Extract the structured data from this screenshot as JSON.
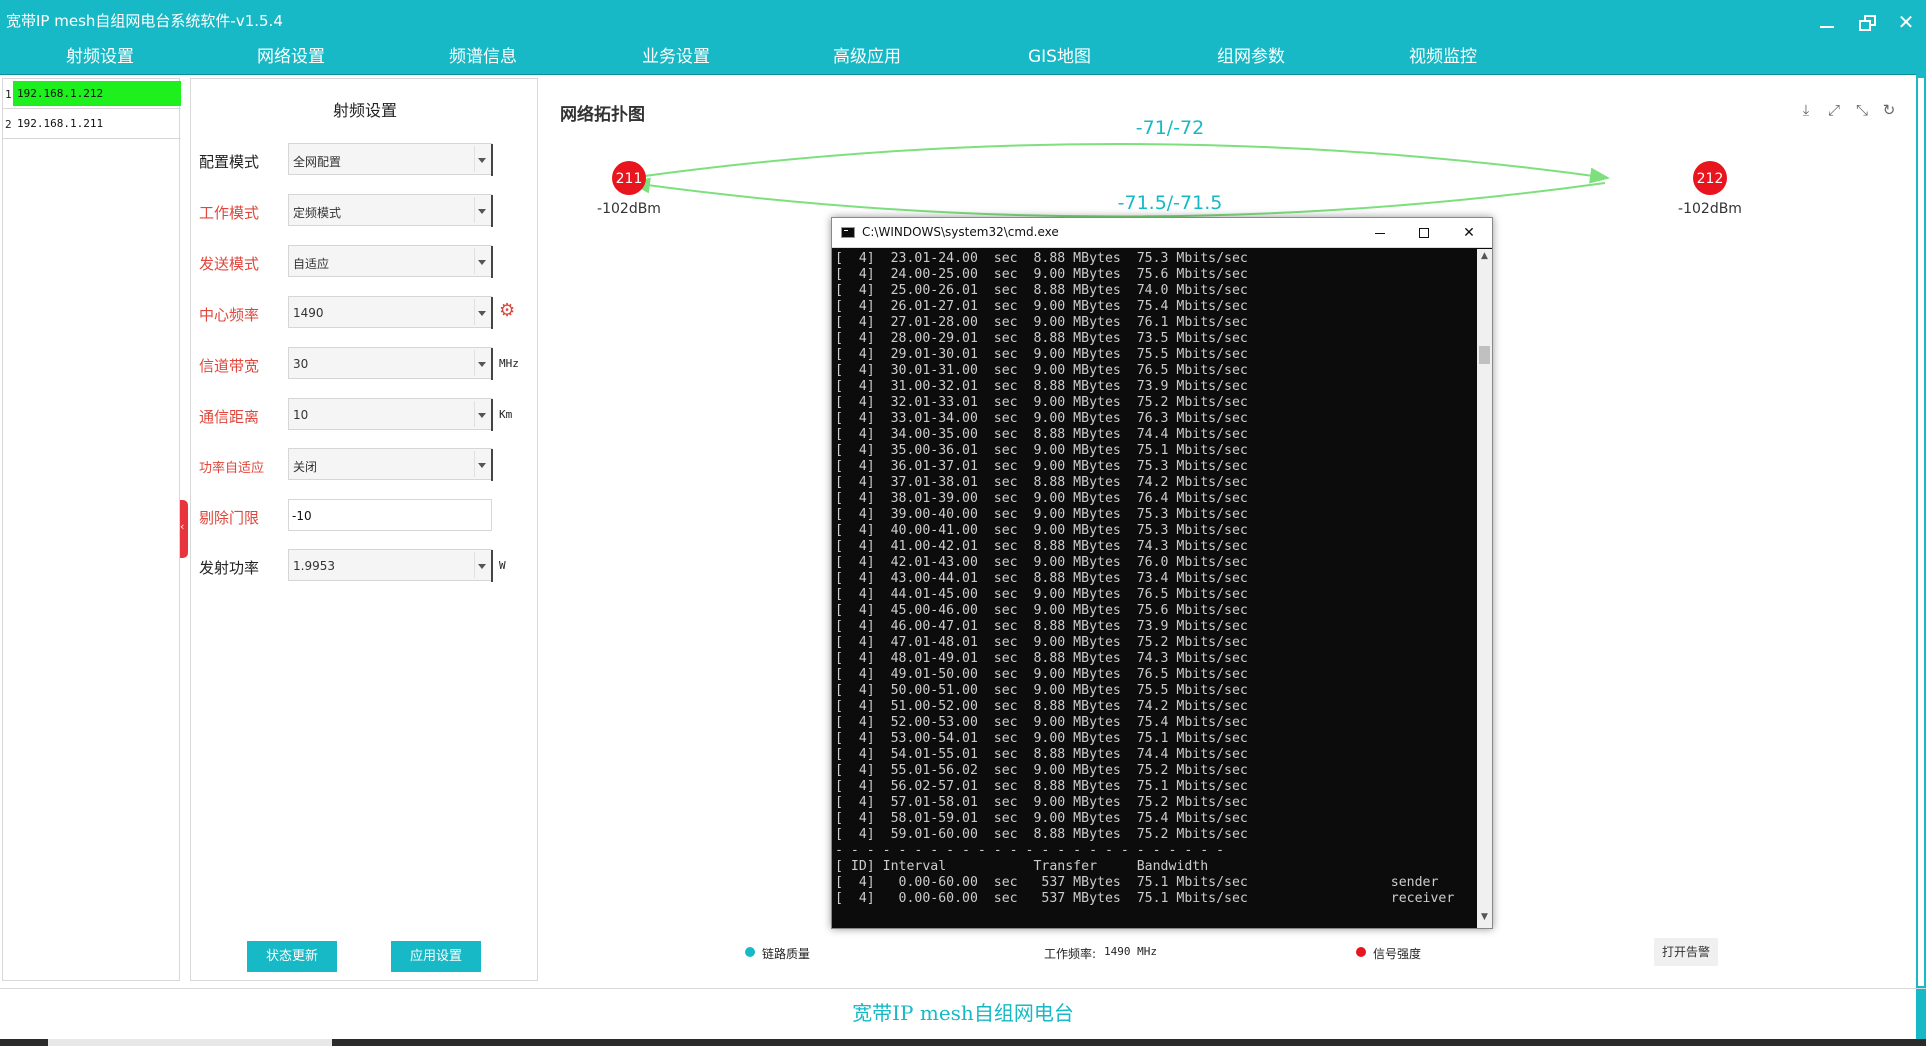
{
  "app": {
    "title": "宽带IP mesh自组网电台系统软件-v1.5.4",
    "footer": "宽带IP mesh自组网电台"
  },
  "menu": [
    "射频设置",
    "网络设置",
    "频谱信息",
    "业务设置",
    "高级应用",
    "GIS地图",
    "组网参数",
    "视频监控"
  ],
  "devices": [
    {
      "index": "1",
      "ip": "192.168.1.212",
      "selected": true
    },
    {
      "index": "2",
      "ip": "192.168.1.211",
      "selected": false
    }
  ],
  "config": {
    "title": "射频设置",
    "rows": [
      {
        "label": "配置模式",
        "value": "全网配置",
        "type": "select",
        "label_color": "black"
      },
      {
        "label": "工作模式",
        "value": "定频模式",
        "type": "select",
        "label_color": "red"
      },
      {
        "label": "发送模式",
        "value": "自适应",
        "type": "select",
        "label_color": "red"
      },
      {
        "label": "中心频率",
        "value": "1490",
        "type": "select",
        "label_color": "red",
        "extra": "gear"
      },
      {
        "label": "信道带宽",
        "value": "30",
        "type": "select",
        "label_color": "red",
        "unit": "MHz"
      },
      {
        "label": "通信距离",
        "value": "10",
        "type": "select",
        "label_color": "red",
        "unit": "Km"
      },
      {
        "label": "功率自适应",
        "value": "关闭",
        "type": "select",
        "label_color": "red"
      },
      {
        "label": "剔除门限",
        "value": "-10",
        "type": "input",
        "label_color": "red"
      },
      {
        "label": "发射功率",
        "value": "1.9953",
        "type": "select",
        "label_color": "black",
        "unit": "W"
      }
    ],
    "status_button": "状态更新",
    "apply_button": "应用设置"
  },
  "topology": {
    "title": "网络拓扑图",
    "node_left": {
      "id": "211",
      "signal": "-102dBm"
    },
    "node_right": {
      "id": "212",
      "signal": "-102dBm"
    },
    "link_top": "-71/-72",
    "link_bottom": "-71.5/-71.5",
    "node_color": "#e8141e",
    "link_color": "#7de07d",
    "link_label_color": "#17b9c6"
  },
  "legend": {
    "quality": "链路质量",
    "frequency_label": "工作频率:",
    "frequency_value": "1490 MHz",
    "signal": "信号强度",
    "alarm_button": "打开告警"
  },
  "cmd": {
    "title": "C:\\WINDOWS\\system32\\cmd.exe",
    "lines": [
      "[  4]  23.01-24.00  sec  8.88 MBytes  75.3 Mbits/sec",
      "[  4]  24.00-25.00  sec  9.00 MBytes  75.6 Mbits/sec",
      "[  4]  25.00-26.01  sec  8.88 MBytes  74.0 Mbits/sec",
      "[  4]  26.01-27.01  sec  9.00 MBytes  75.4 Mbits/sec",
      "[  4]  27.01-28.00  sec  9.00 MBytes  76.1 Mbits/sec",
      "[  4]  28.00-29.01  sec  8.88 MBytes  73.5 Mbits/sec",
      "[  4]  29.01-30.01  sec  9.00 MBytes  75.5 Mbits/sec",
      "[  4]  30.01-31.00  sec  9.00 MBytes  76.5 Mbits/sec",
      "[  4]  31.00-32.01  sec  8.88 MBytes  73.9 Mbits/sec",
      "[  4]  32.01-33.01  sec  9.00 MBytes  75.2 Mbits/sec",
      "[  4]  33.01-34.00  sec  9.00 MBytes  76.3 Mbits/sec",
      "[  4]  34.00-35.00  sec  8.88 MBytes  74.4 Mbits/sec",
      "[  4]  35.00-36.01  sec  9.00 MBytes  75.1 Mbits/sec",
      "[  4]  36.01-37.01  sec  9.00 MBytes  75.3 Mbits/sec",
      "[  4]  37.01-38.01  sec  8.88 MBytes  74.2 Mbits/sec",
      "[  4]  38.01-39.00  sec  9.00 MBytes  76.4 Mbits/sec",
      "[  4]  39.00-40.00  sec  9.00 MBytes  75.3 Mbits/sec",
      "[  4]  40.00-41.00  sec  9.00 MBytes  75.3 Mbits/sec",
      "[  4]  41.00-42.01  sec  8.88 MBytes  74.3 Mbits/sec",
      "[  4]  42.01-43.00  sec  9.00 MBytes  76.0 Mbits/sec",
      "[  4]  43.00-44.01  sec  8.88 MBytes  73.4 Mbits/sec",
      "[  4]  44.01-45.00  sec  9.00 MBytes  76.5 Mbits/sec",
      "[  4]  45.00-46.00  sec  9.00 MBytes  75.6 Mbits/sec",
      "[  4]  46.00-47.01  sec  8.88 MBytes  73.9 Mbits/sec",
      "[  4]  47.01-48.01  sec  9.00 MBytes  75.2 Mbits/sec",
      "[  4]  48.01-49.01  sec  8.88 MBytes  74.3 Mbits/sec",
      "[  4]  49.01-50.00  sec  9.00 MBytes  76.5 Mbits/sec",
      "[  4]  50.00-51.00  sec  9.00 MBytes  75.5 Mbits/sec",
      "[  4]  51.00-52.00  sec  8.88 MBytes  74.2 Mbits/sec",
      "[  4]  52.00-53.00  sec  9.00 MBytes  75.4 Mbits/sec",
      "[  4]  53.00-54.01  sec  9.00 MBytes  75.1 Mbits/sec",
      "[  4]  54.01-55.01  sec  8.88 MBytes  74.4 Mbits/sec",
      "[  4]  55.01-56.02  sec  9.00 MBytes  75.2 Mbits/sec",
      "[  4]  56.02-57.01  sec  8.88 MBytes  75.1 Mbits/sec",
      "[  4]  57.01-58.01  sec  9.00 MBytes  75.2 Mbits/sec",
      "[  4]  58.01-59.01  sec  9.00 MBytes  75.4 Mbits/sec",
      "[  4]  59.01-60.00  sec  8.88 MBytes  75.2 Mbits/sec",
      "- - - - - - - - - - - - - - - - - - - - - - - - -",
      "[ ID] Interval           Transfer     Bandwidth",
      "[  4]   0.00-60.00  sec   537 MBytes  75.1 Mbits/sec                  sender",
      "[  4]   0.00-60.00  sec   537 MBytes  75.1 Mbits/sec                  receiver"
    ]
  },
  "icons": {
    "download": "download-icon",
    "fullscreen": "fullscreen-icon",
    "collapse": "collapse-icon",
    "refresh": "refresh-icon",
    "gear": "gear-icon"
  }
}
